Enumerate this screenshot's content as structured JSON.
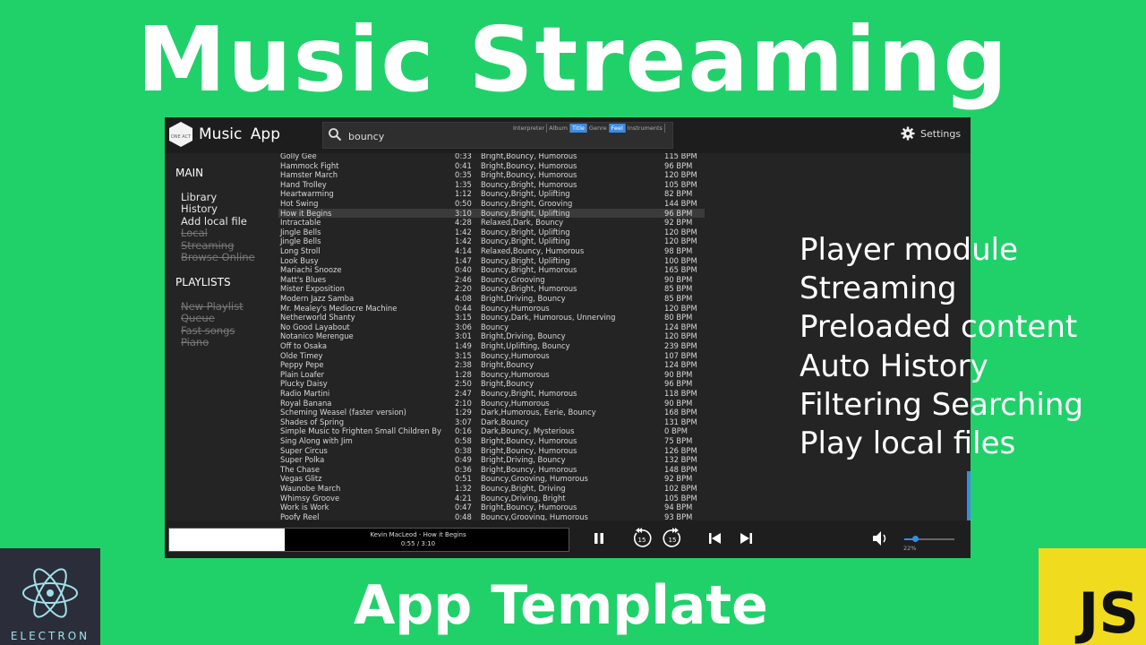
{
  "headline": "Music Streaming",
  "subheadline": "App Template",
  "features": [
    "Player module",
    "Streaming",
    "Preloaded content",
    "Auto History",
    "Filtering Searching",
    "Play local files"
  ],
  "logos": {
    "electron_label": "ELECTRON",
    "js_label": "JS"
  },
  "app": {
    "brand": "ONE ACT",
    "title": "Music App",
    "search": {
      "value": "bouncy",
      "placeholder": ""
    },
    "filters": [
      {
        "label": "Interpreter",
        "active": false
      },
      {
        "label": "Album",
        "active": false
      },
      {
        "label": "Title",
        "active": true
      },
      {
        "label": "Genre",
        "active": false
      },
      {
        "label": "Feel",
        "active": true
      },
      {
        "label": "Instruments",
        "active": false
      }
    ],
    "settings_label": "Settings",
    "sidebar": {
      "main_heading": "MAIN",
      "main_items": [
        {
          "label": "Library",
          "disabled": false
        },
        {
          "label": "History",
          "disabled": false
        },
        {
          "label": "Add local file",
          "disabled": false
        },
        {
          "label": "Local",
          "disabled": true
        },
        {
          "label": "Streaming",
          "disabled": true
        },
        {
          "label": "Browse Online",
          "disabled": true
        }
      ],
      "playlists_heading": "PLAYLISTS",
      "playlist_items": [
        {
          "label": "New Playlist",
          "disabled": true
        },
        {
          "label": "Queue",
          "disabled": true
        },
        {
          "label": "Fast songs",
          "disabled": true
        },
        {
          "label": "Piano",
          "disabled": true
        }
      ]
    },
    "tracks": [
      {
        "title": "Golly Gee",
        "duration": "0:33",
        "feel": "Bright,Bouncy, Humorous",
        "bpm": "115 BPM"
      },
      {
        "title": "Hammock Fight",
        "duration": "0:41",
        "feel": "Bright,Bouncy, Humorous",
        "bpm": "96 BPM"
      },
      {
        "title": "Hamster March",
        "duration": "0:35",
        "feel": "Bright,Bouncy, Humorous",
        "bpm": "120 BPM"
      },
      {
        "title": "Hand Trolley",
        "duration": "1:35",
        "feel": "Bouncy,Bright, Humorous",
        "bpm": "105 BPM"
      },
      {
        "title": "Heartwarming",
        "duration": "1:12",
        "feel": "Bouncy,Bright, Uplifting",
        "bpm": "82 BPM"
      },
      {
        "title": "Hot Swing",
        "duration": "0:50",
        "feel": "Bouncy,Bright, Grooving",
        "bpm": "144 BPM"
      },
      {
        "title": "How it Begins",
        "duration": "3:10",
        "feel": "Bouncy,Bright, Uplifting",
        "bpm": "96 BPM",
        "selected": true
      },
      {
        "title": "Intractable",
        "duration": "4:28",
        "feel": "Relaxed,Dark, Bouncy",
        "bpm": "92 BPM"
      },
      {
        "title": "Jingle Bells",
        "duration": "1:42",
        "feel": "Bouncy,Bright, Uplifting",
        "bpm": "120 BPM"
      },
      {
        "title": "Jingle Bells",
        "duration": "1:42",
        "feel": "Bouncy,Bright, Uplifting",
        "bpm": "120 BPM"
      },
      {
        "title": "Long Stroll",
        "duration": "4:14",
        "feel": "Relaxed,Bouncy, Humorous",
        "bpm": "98 BPM"
      },
      {
        "title": "Look Busy",
        "duration": "1:47",
        "feel": "Bouncy,Bright, Uplifting",
        "bpm": "100 BPM"
      },
      {
        "title": "Mariachi Snooze",
        "duration": "0:40",
        "feel": "Bouncy,Bright, Humorous",
        "bpm": "165 BPM"
      },
      {
        "title": "Matt's Blues",
        "duration": "2:46",
        "feel": "Bouncy,Grooving",
        "bpm": "90 BPM"
      },
      {
        "title": "Mister Exposition",
        "duration": "2:20",
        "feel": "Bouncy,Bright, Humorous",
        "bpm": "85 BPM"
      },
      {
        "title": "Modern Jazz Samba",
        "duration": "4:08",
        "feel": "Bright,Driving, Bouncy",
        "bpm": "85 BPM"
      },
      {
        "title": "Mr. Mealey's Mediocre Machine",
        "duration": "0:44",
        "feel": "Bouncy,Humorous",
        "bpm": "120 BPM"
      },
      {
        "title": "Netherworld Shanty",
        "duration": "3:15",
        "feel": "Bouncy,Dark, Humorous, Unnerving",
        "bpm": "80 BPM"
      },
      {
        "title": "No Good Layabout",
        "duration": "3:06",
        "feel": "Bouncy",
        "bpm": "124 BPM"
      },
      {
        "title": "Notanico Merengue",
        "duration": "3:01",
        "feel": "Bright,Driving, Bouncy",
        "bpm": "120 BPM"
      },
      {
        "title": "Off to Osaka",
        "duration": "1:49",
        "feel": "Bright,Uplifting, Bouncy",
        "bpm": "239 BPM"
      },
      {
        "title": "Olde Timey",
        "duration": "3:15",
        "feel": "Bouncy,Humorous",
        "bpm": "107 BPM"
      },
      {
        "title": "Peppy Pepe",
        "duration": "2:38",
        "feel": "Bright,Bouncy",
        "bpm": "124 BPM"
      },
      {
        "title": "Plain Loafer",
        "duration": "1:28",
        "feel": "Bouncy,Humorous",
        "bpm": "90 BPM"
      },
      {
        "title": "Plucky Daisy",
        "duration": "2:50",
        "feel": "Bright,Bouncy",
        "bpm": "96 BPM"
      },
      {
        "title": "Radio Martini",
        "duration": "2:47",
        "feel": "Bouncy,Bright, Humorous",
        "bpm": "118 BPM"
      },
      {
        "title": "Royal Banana",
        "duration": "2:10",
        "feel": "Bouncy,Humorous",
        "bpm": "90 BPM"
      },
      {
        "title": "Scheming Weasel (faster version)",
        "duration": "1:29",
        "feel": "Dark,Humorous, Eerie, Bouncy",
        "bpm": "168 BPM"
      },
      {
        "title": "Shades of Spring",
        "duration": "3:07",
        "feel": "Dark,Bouncy",
        "bpm": "131 BPM"
      },
      {
        "title": "Simple Music to Frighten Small Children By",
        "duration": "0:16",
        "feel": "Dark,Bouncy, Mysterious",
        "bpm": "0 BPM"
      },
      {
        "title": "Sing Along with Jim",
        "duration": "0:58",
        "feel": "Bright,Bouncy, Humorous",
        "bpm": "75 BPM"
      },
      {
        "title": "Super Circus",
        "duration": "0:38",
        "feel": "Bright,Bouncy, Humorous",
        "bpm": "126 BPM"
      },
      {
        "title": "Super Polka",
        "duration": "0:49",
        "feel": "Bright,Driving, Bouncy",
        "bpm": "132 BPM"
      },
      {
        "title": "The Chase",
        "duration": "0:36",
        "feel": "Bright,Bouncy, Humorous",
        "bpm": "148 BPM"
      },
      {
        "title": "Vegas Glitz",
        "duration": "0:51",
        "feel": "Bouncy,Grooving, Humorous",
        "bpm": "92 BPM"
      },
      {
        "title": "Waunobe March",
        "duration": "1:32",
        "feel": "Bouncy,Bright, Driving",
        "bpm": "102 BPM"
      },
      {
        "title": "Whimsy Groove",
        "duration": "4:21",
        "feel": "Bouncy,Driving, Bright",
        "bpm": "105 BPM"
      },
      {
        "title": "Work is Work",
        "duration": "0:47",
        "feel": "Bright,Bouncy, Humorous",
        "bpm": "94 BPM"
      },
      {
        "title": "Poofy Reel",
        "duration": "0:48",
        "feel": "Bouncy,Grooving, Humorous",
        "bpm": "93 BPM"
      }
    ],
    "player": {
      "now_playing": "Kevin MacLeod - How it Begins",
      "time": "0:55 / 3:10",
      "progress": 0.29,
      "volume_label": "22%",
      "volume": 0.22,
      "rewind_seconds": "15",
      "forward_seconds": "15"
    },
    "colors": {
      "accent": "#3a8be6",
      "background": "#20d16a",
      "window": "#242424"
    }
  }
}
